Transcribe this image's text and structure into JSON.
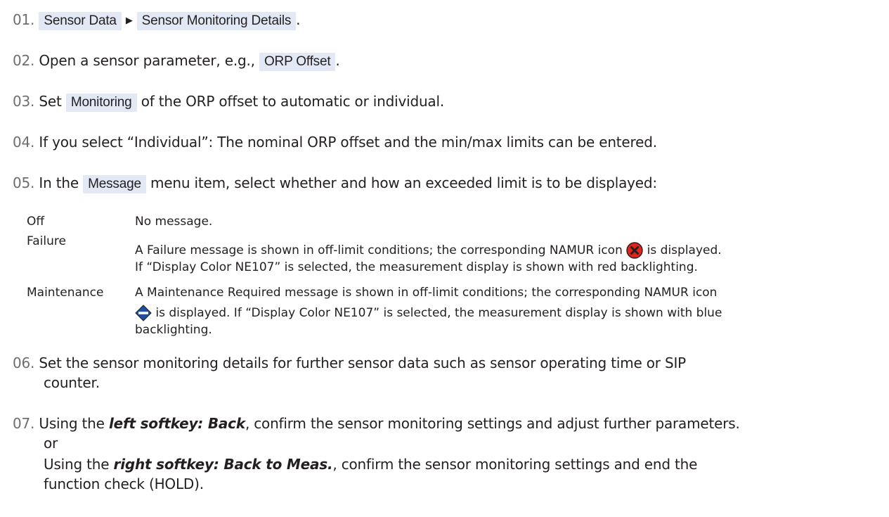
{
  "steps": [
    {
      "num": "01.",
      "crumb1": "Sensor Data",
      "crumb2": "Sensor Monitoring Details",
      "end": "."
    },
    {
      "num": "02.",
      "pre": "Open a sensor parameter, e.g.,",
      "ui": "ORP Offset",
      "end": "."
    },
    {
      "num": "03.",
      "pre": "Set",
      "ui": "Monitoring",
      "post": "of the ORP offset to automatic or individual."
    },
    {
      "num": "04.",
      "text": "If you select “Individual”: The nominal ORP offset and the min/max limits can be entered."
    },
    {
      "num": "05.",
      "pre": "In the",
      "ui": "Message",
      "post": "menu item, select whether and how an exceeded limit is to be displayed:"
    },
    {
      "num": "06.",
      "line1": "Set the sensor monitoring details for further sensor data such as sensor operating time or SIP",
      "line2": "counter."
    },
    {
      "num": "07.",
      "a_pre": "Using the",
      "a_key": "left softkey: Back",
      "a_post": ", confirm the sensor monitoring settings and adjust further parameters.",
      "or": "or",
      "b_pre": "Using the",
      "b_key": "right softkey: Back to Meas.",
      "b_post": ", confirm the sensor monitoring settings and end the",
      "b_line2": "function check (HOLD)."
    }
  ],
  "options": [
    {
      "term": "Off",
      "desc": "No message."
    },
    {
      "term": "Failure",
      "desc1_pre": "A Failure message is shown in off-limit conditions; the corresponding NAMUR icon",
      "desc1_post": "is displayed.",
      "desc2": "If “Display Color NE107” is selected, the measurement display is shown with red backlighting.",
      "icon": "namur-failure-icon",
      "icon_color": "#e2231a"
    },
    {
      "term": "Maintenance",
      "desc1": "A Maintenance Required message is shown in off-limit conditions; the corresponding NAMUR icon",
      "desc2_post": "is displayed. If “Display Color NE107” is selected, the measurement display is shown with blue",
      "desc3": "backlighting.",
      "icon": "namur-maintenance-icon",
      "icon_color": "#1e4fa0"
    }
  ]
}
